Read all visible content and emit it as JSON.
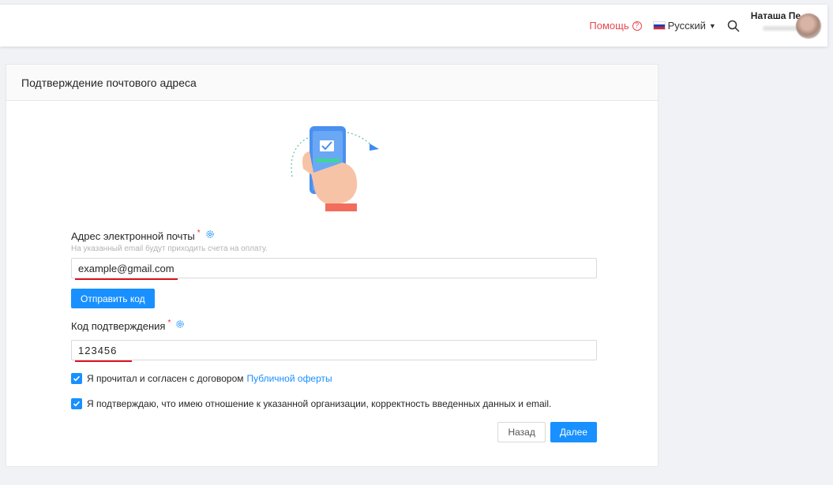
{
  "header": {
    "help_label": "Помощь",
    "help_icon": "question-circle-icon",
    "language_label": "Русский",
    "user_name": "Наташа Пе",
    "colors": {
      "help": "#e8474f"
    }
  },
  "card": {
    "title": "Подтверждение почтового адреса"
  },
  "form": {
    "email": {
      "label": "Адрес электронной почты",
      "required_mark": "*",
      "hint": "На указанный email будут приходить счета на оплату.",
      "value": "example@gmail.com"
    },
    "send_code_label": "Отправить код",
    "code": {
      "label": "Код подтверждения",
      "required_mark": "*",
      "value": "123456"
    },
    "agree_offer": {
      "text": "Я прочитал и согласен с договором",
      "link": "Публичной оферты",
      "checked": true
    },
    "agree_org": {
      "text": "Я подтверждаю, что имею отношение к указанной организации, корректность введенных данных и email.",
      "checked": true
    },
    "back_label": "Назад",
    "next_label": "Далее"
  },
  "colors": {
    "primary": "#1890ff",
    "annotation_underline": "#e0141e",
    "required": "#f5222d"
  }
}
